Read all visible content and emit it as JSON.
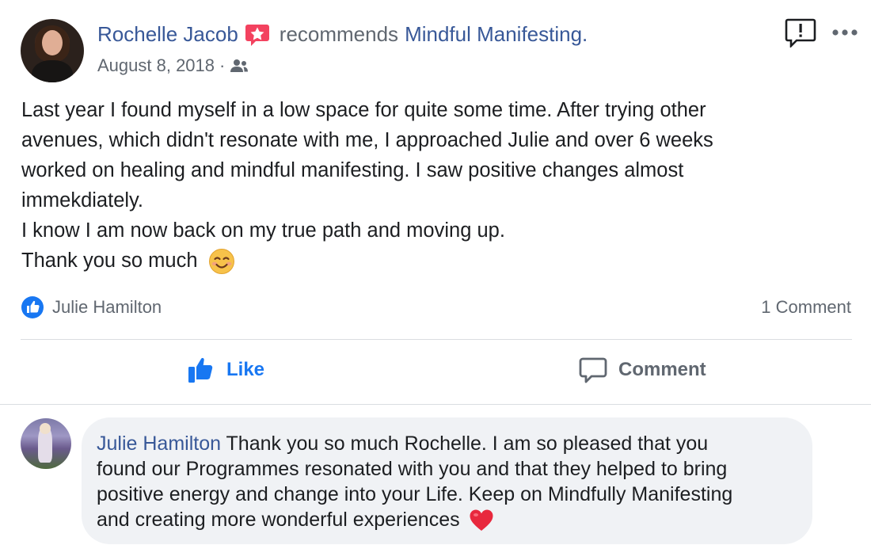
{
  "post": {
    "author": "Rochelle Jacob",
    "action": "recommends",
    "page": "Mindful Manifesting.",
    "date": "August 8, 2018",
    "separator": "·",
    "audience_icon": "friends-icon",
    "text_lines": [
      "Last year I found myself in a low space for quite some time. After trying other",
      "avenues, which didn't resonate with me, I approached Julie and over 6 weeks",
      "worked on healing and mindful manifesting. I saw positive changes almost",
      "immekdiately.",
      "I know I am now back on my true path and moving up.",
      "Thank you so much"
    ],
    "emoji": "smiling-face-with-smiling-eyes"
  },
  "reactions": {
    "reactor": "Julie Hamilton",
    "comment_count": "1 Comment"
  },
  "actions": {
    "like_label": "Like",
    "comment_label": "Comment"
  },
  "comment": {
    "author": "Julie Hamilton",
    "lines": [
      "Thank you so much Rochelle. I am so pleased that you",
      "found our Programmes resonated with you and that they helped to bring",
      "positive energy and change into your Life. Keep on Mindfully Manifesting",
      "and creating more wonderful experiences"
    ],
    "emoji": "red-heart"
  },
  "colors": {
    "link_blue": "#385898",
    "like_blue": "#1877f2",
    "muted_gray": "#606770",
    "bubble_bg": "#f0f2f5",
    "recommend_badge": "#f3425f"
  }
}
